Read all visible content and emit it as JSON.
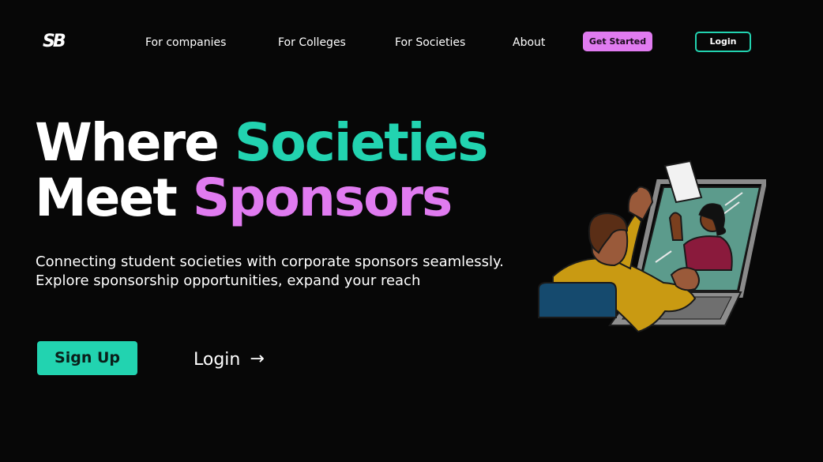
{
  "brand": {
    "logo_text": "SB"
  },
  "nav": {
    "links": [
      "For companies",
      "For Colleges",
      "For Societies",
      "About"
    ],
    "get_started": "Get Started",
    "login": "Login"
  },
  "hero": {
    "title_line1_a": "Where",
    "title_line1_b": "Societies",
    "title_line2_a": "Meet",
    "title_line2_b": "Sponsors",
    "subtitle_line1": "Connecting student societies with corporate sponsors seamlessly.",
    "subtitle_line2": "Explore sponsorship opportunities, expand your reach",
    "signup_label": "Sign Up",
    "login_label": "Login",
    "arrow_icon": "arrow-right-icon"
  },
  "colors": {
    "background": "#070707",
    "accent_teal": "#22d3b0",
    "accent_pink": "#e07bf0"
  }
}
